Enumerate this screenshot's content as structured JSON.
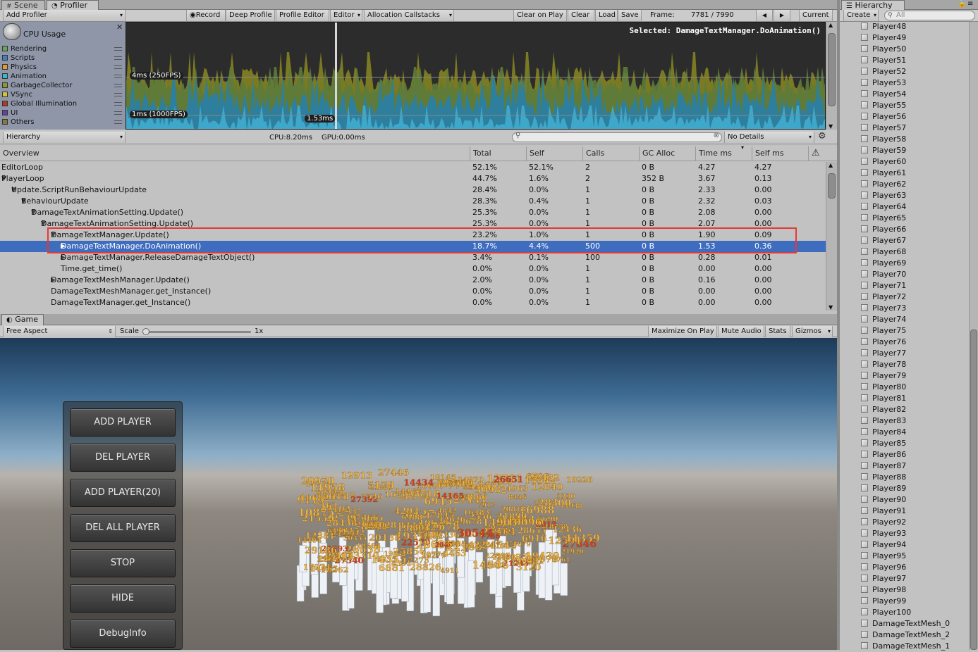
{
  "tabs": {
    "scene": "Scene",
    "profiler": "Profiler",
    "game": "Game",
    "hierarchy": "Hierarchy"
  },
  "profiler_toolbar": {
    "add_profiler": "Add Profiler",
    "record": "Record",
    "deep_profile": "Deep Profile",
    "profile_editor": "Profile Editor",
    "editor": "Editor",
    "allocation_callstacks": "Allocation Callstacks",
    "clear_on_play": "Clear on Play",
    "clear": "Clear",
    "load": "Load",
    "save": "Save",
    "frame_label": "Frame:",
    "frame_value": "7781 / 7990",
    "current": "Current"
  },
  "cpu_panel": {
    "title": "CPU Usage",
    "legend": [
      {
        "label": "Rendering",
        "color": "#6aa84f"
      },
      {
        "label": "Scripts",
        "color": "#3b82c4"
      },
      {
        "label": "Physics",
        "color": "#e09b2d"
      },
      {
        "label": "Animation",
        "color": "#39b8c8"
      },
      {
        "label": "GarbageCollector",
        "color": "#8a9a2a"
      },
      {
        "label": "VSync",
        "color": "#d6c23a"
      },
      {
        "label": "Global Illumination",
        "color": "#b03a2e"
      },
      {
        "label": "UI",
        "color": "#6a3fa0"
      },
      {
        "label": "Others",
        "color": "#8a7a3a"
      }
    ],
    "selected_label": "Selected: DamageTextManager.DoAnimation()",
    "line_4ms": "4ms (250FPS)",
    "line_1ms": "1ms (1000FPS)",
    "selected_value": "1.53ms"
  },
  "details_bar": {
    "view_mode": "Hierarchy",
    "cpu": "CPU:8.20ms",
    "gpu": "GPU:0.00ms",
    "search_placeholder": "",
    "no_details": "No Details"
  },
  "table": {
    "headers": [
      "Overview",
      "Total",
      "Self",
      "Calls",
      "GC Alloc",
      "Time ms",
      "Self ms"
    ],
    "rows": [
      {
        "name": "EditorLoop",
        "total": "52.1%",
        "self": "52.1%",
        "calls": "2",
        "gc": "0 B",
        "time": "4.27",
        "selfms": "4.27"
      },
      {
        "name": "PlayerLoop",
        "total": "44.7%",
        "self": "1.6%",
        "calls": "2",
        "gc": "352 B",
        "time": "3.67",
        "selfms": "0.13"
      },
      {
        "name": "Update.ScriptRunBehaviourUpdate",
        "total": "28.4%",
        "self": "0.0%",
        "calls": "1",
        "gc": "0 B",
        "time": "2.33",
        "selfms": "0.00"
      },
      {
        "name": "BehaviourUpdate",
        "total": "28.3%",
        "self": "0.4%",
        "calls": "1",
        "gc": "0 B",
        "time": "2.32",
        "selfms": "0.03"
      },
      {
        "name": "DamageTextAnimationSetting.Update()",
        "total": "25.3%",
        "self": "0.0%",
        "calls": "1",
        "gc": "0 B",
        "time": "2.08",
        "selfms": "0.00"
      },
      {
        "name": "DamageTextAnimationSetting.Update()",
        "total": "25.3%",
        "self": "0.0%",
        "calls": "1",
        "gc": "0 B",
        "time": "2.07",
        "selfms": "0.00"
      },
      {
        "name": "DamageTextManager.Update()",
        "total": "23.2%",
        "self": "1.0%",
        "calls": "1",
        "gc": "0 B",
        "time": "1.90",
        "selfms": "0.09"
      },
      {
        "name": "DamageTextManager.DoAnimation()",
        "total": "18.7%",
        "self": "4.4%",
        "calls": "500",
        "gc": "0 B",
        "time": "1.53",
        "selfms": "0.36"
      },
      {
        "name": "DamageTextManager.ReleaseDamageTextObject()",
        "total": "3.4%",
        "self": "0.1%",
        "calls": "100",
        "gc": "0 B",
        "time": "0.28",
        "selfms": "0.01"
      },
      {
        "name": "Time.get_time()",
        "total": "0.0%",
        "self": "0.0%",
        "calls": "1",
        "gc": "0 B",
        "time": "0.00",
        "selfms": "0.00"
      },
      {
        "name": "DamageTextMeshManager.Update()",
        "total": "2.0%",
        "self": "0.0%",
        "calls": "1",
        "gc": "0 B",
        "time": "0.16",
        "selfms": "0.00"
      },
      {
        "name": "DamageTextMeshManager.get_Instance()",
        "total": "0.0%",
        "self": "0.0%",
        "calls": "1",
        "gc": "0 B",
        "time": "0.00",
        "selfms": "0.00"
      },
      {
        "name": "DamageTextManager.get_Instance()",
        "total": "0.0%",
        "self": "0.0%",
        "calls": "1",
        "gc": "0 B",
        "time": "0.00",
        "selfms": "0.00"
      }
    ]
  },
  "game_toolbar": {
    "aspect": "Free Aspect",
    "scale_label": "Scale",
    "scale_value": "1x",
    "maximize_on_play": "Maximize On Play",
    "mute_audio": "Mute Audio",
    "stats": "Stats",
    "gizmos": "Gizmos"
  },
  "game_buttons": [
    "ADD PLAYER",
    "DEL PLAYER",
    "ADD PLAYER(20)",
    "DEL ALL PLAYER",
    "STOP",
    "HIDE",
    "DebugInfo"
  ],
  "hierarchy": {
    "create": "Create",
    "search_placeholder": "All",
    "items": [
      "Player48",
      "Player49",
      "Player50",
      "Player51",
      "Player52",
      "Player53",
      "Player54",
      "Player55",
      "Player56",
      "Player57",
      "Player58",
      "Player59",
      "Player60",
      "Player61",
      "Player62",
      "Player63",
      "Player64",
      "Player65",
      "Player66",
      "Player67",
      "Player68",
      "Player69",
      "Player70",
      "Player71",
      "Player72",
      "Player73",
      "Player74",
      "Player75",
      "Player76",
      "Player77",
      "Player78",
      "Player79",
      "Player80",
      "Player81",
      "Player82",
      "Player83",
      "Player84",
      "Player85",
      "Player86",
      "Player87",
      "Player88",
      "Player89",
      "Player90",
      "Player91",
      "Player92",
      "Player93",
      "Player94",
      "Player95",
      "Player96",
      "Player97",
      "Player98",
      "Player99",
      "Player100",
      "DamageTextMesh_0",
      "DamageTextMesh_2",
      "DamageTextMesh_1"
    ]
  }
}
